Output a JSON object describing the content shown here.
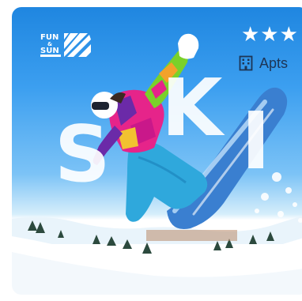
{
  "card": {
    "title_letters": [
      "S",
      "K",
      "I"
    ],
    "rating_stars": "★★★",
    "rating_value": 3,
    "rating_max": 3,
    "accommodation_type": "Apts",
    "accommodation_icon": "building-icon",
    "brand_logo": "fun-and-sun-logo",
    "brand_logo_text": [
      "FUN",
      "&",
      "SUN"
    ]
  },
  "colors": {
    "sky_top": "#1f86e0",
    "sky_light": "#7cc3f6",
    "snow": "#ffffff",
    "label_text": "#1d3556",
    "jacket_pink": "#e6248a",
    "jacket_purple": "#6b2aa8",
    "jacket_green": "#7ad12a",
    "pants_blue": "#2fa8dc",
    "board_blue": "#3a7fd0"
  }
}
